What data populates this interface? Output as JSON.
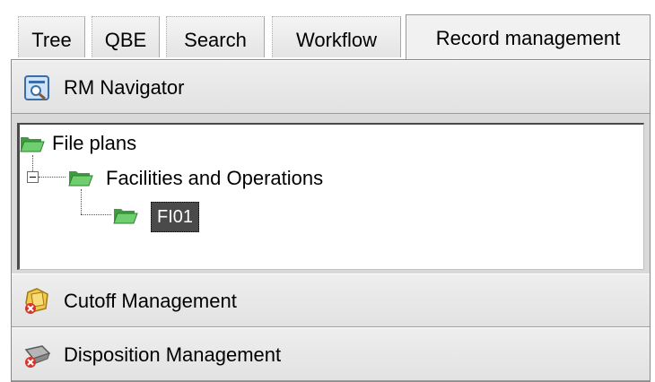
{
  "tabs": [
    {
      "label": "Tree",
      "active": false
    },
    {
      "label": "QBE",
      "active": false
    },
    {
      "label": "Search",
      "active": false
    },
    {
      "label": "Workflow",
      "active": false
    },
    {
      "label": "Record management",
      "active": true
    }
  ],
  "navigator": {
    "title": "RM Navigator",
    "icon": "rm-navigator-icon"
  },
  "tree": {
    "root": {
      "label": "File plans",
      "icon": "folder-open-icon"
    },
    "child": {
      "label": "Facilities and Operations",
      "icon": "folder-open-icon",
      "expanded": true
    },
    "grandchild": {
      "label": "FI01",
      "icon": "folder-open-icon",
      "selected": true
    }
  },
  "sections": [
    {
      "title": "Cutoff Management",
      "icon": "cutoff-management-icon"
    },
    {
      "title": "Disposition Management",
      "icon": "disposition-management-icon"
    }
  ],
  "colors": {
    "folder": "#5cb85c",
    "selection_bg": "#4a4a4a",
    "panel_bg": "#d9d9d9"
  }
}
